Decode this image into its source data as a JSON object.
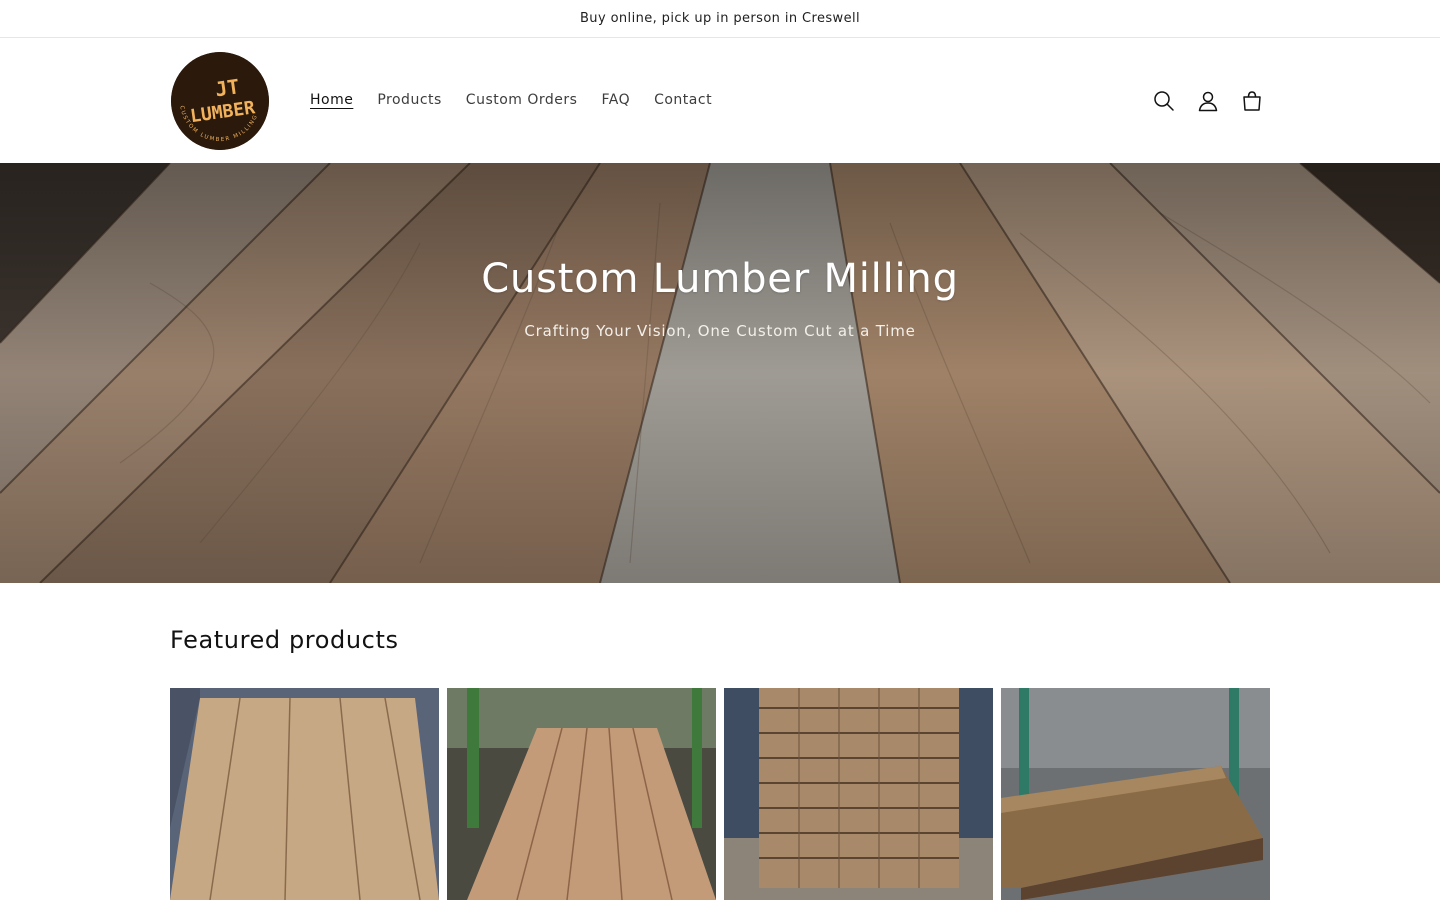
{
  "announcement": {
    "text": "Buy online, pick up in person in Creswell"
  },
  "header": {
    "logo": {
      "line1": "JT",
      "line2": "LUMBER",
      "ring_text": "CUSTOM LUMBER MILLING",
      "bg_color": "#2b1a0c",
      "text_color": "#f2b25c"
    },
    "nav": [
      {
        "label": "Home",
        "active": true
      },
      {
        "label": "Products",
        "active": false
      },
      {
        "label": "Custom Orders",
        "active": false
      },
      {
        "label": "FAQ",
        "active": false
      },
      {
        "label": "Contact",
        "active": false
      }
    ],
    "icons": [
      "search-icon",
      "account-icon",
      "cart-icon"
    ]
  },
  "hero": {
    "title": "Custom Lumber Milling",
    "subtitle": "Crafting Your Vision, One Custom Cut at a Time"
  },
  "featured": {
    "title": "Featured products",
    "products": [
      {
        "image": "cedar-boards-on-floor"
      },
      {
        "image": "cedar-boards-on-sawhorses"
      },
      {
        "image": "stacked-lumber-pile"
      },
      {
        "image": "rough-board-closeup"
      }
    ]
  }
}
